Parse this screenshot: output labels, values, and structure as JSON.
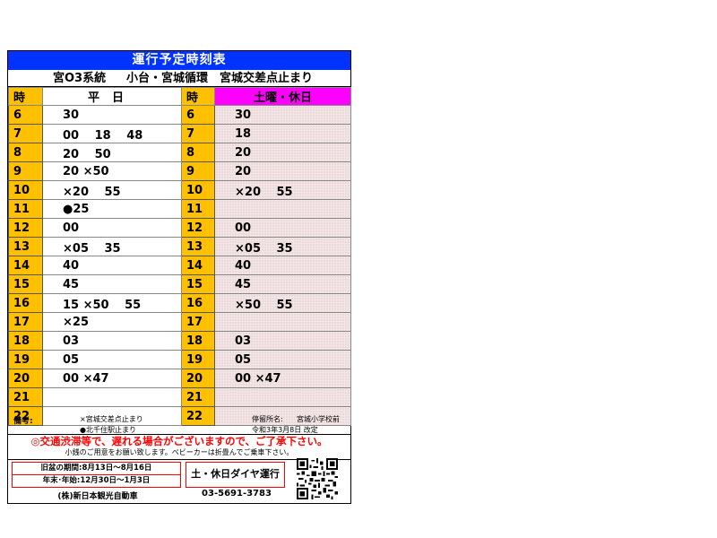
{
  "title": "運行予定時刻表",
  "route": {
    "system": "宮O3系統",
    "line": "小台・宮城循環",
    "stop_type": "宮城交差点止まり"
  },
  "headers": {
    "hour": "時",
    "weekday": "平日",
    "weekend": "土曜・休日"
  },
  "rows": [
    {
      "hour": "6",
      "weekday": "30",
      "weekend": "30"
    },
    {
      "hour": "7",
      "weekday": "00　 18　 48",
      "weekend": "18"
    },
    {
      "hour": "8",
      "weekday": "20　 50",
      "weekend": "20"
    },
    {
      "hour": "9",
      "weekday": "20 ×50",
      "weekend": "20"
    },
    {
      "hour": "10",
      "weekday": "×20　 55",
      "weekend": "×20　 55"
    },
    {
      "hour": "11",
      "weekday": "●25",
      "weekend": ""
    },
    {
      "hour": "12",
      "weekday": "00",
      "weekend": "00"
    },
    {
      "hour": "13",
      "weekday": "×05　 35",
      "weekend": "×05　 35"
    },
    {
      "hour": "14",
      "weekday": "40",
      "weekend": "40"
    },
    {
      "hour": "15",
      "weekday": "45",
      "weekend": "45"
    },
    {
      "hour": "16",
      "weekday": "15 ×50　 55",
      "weekend": "×50　 55"
    },
    {
      "hour": "17",
      "weekday": "×25",
      "weekend": ""
    },
    {
      "hour": "18",
      "weekday": "03",
      "weekend": "03"
    },
    {
      "hour": "19",
      "weekday": "05",
      "weekend": "05"
    },
    {
      "hour": "20",
      "weekday": "00 ×47",
      "weekend": "00 ×47"
    },
    {
      "hour": "21",
      "weekday": "",
      "weekend": ""
    },
    {
      "hour": "22",
      "weekday": "",
      "weekend": ""
    }
  ],
  "notes": {
    "label": "備考:",
    "note1": "×宮城交差点止まり",
    "note2": "●北千住駅止まり",
    "stop_label": "停留所名:",
    "stop_name": "宮城小学校前",
    "revised": "令和3年3月8日 改定"
  },
  "warning": "◎交通渋滞等で、遅れる場合がございますので、ご了承下さい。",
  "sub_warning": "小銭のご用意をお願い致します。ベビーカーは折畳んでご乗車下さい。",
  "periods": {
    "obon": "旧盆の期間:8月13日～8月16日",
    "new_year": "年末･年始:12月30日～1月3日"
  },
  "dia_note": "土・休日ダイヤ運行",
  "company": "(株)新日本観光自動車",
  "phone": "03-5691-3783"
}
